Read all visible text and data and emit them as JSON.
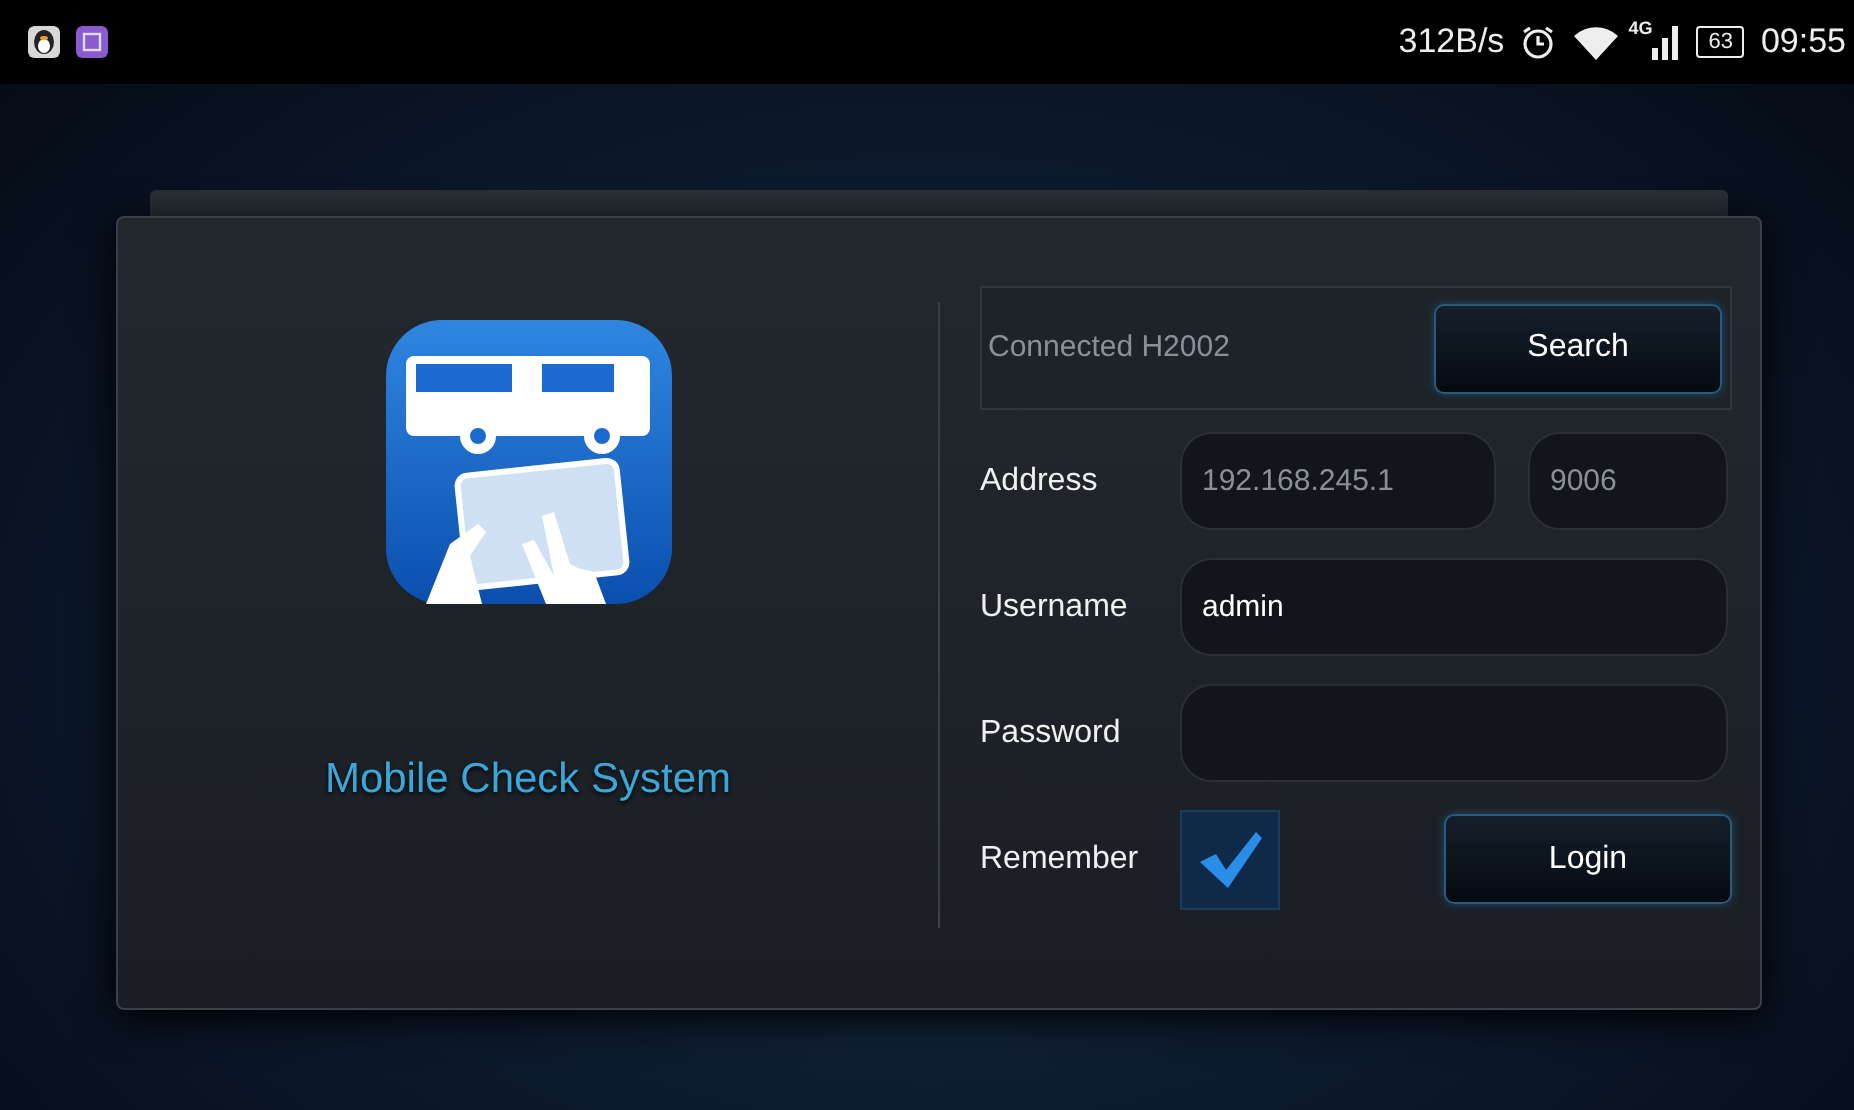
{
  "status_bar": {
    "speed": "312B/s",
    "network": "4G",
    "battery": "63",
    "time": "09:55"
  },
  "app": {
    "title": "Mobile Check System"
  },
  "form": {
    "connection": "Connected H2002",
    "search_button": "Search",
    "address": {
      "label": "Address",
      "host_placeholder": "192.168.245.1",
      "port_placeholder": "9006"
    },
    "username": {
      "label": "Username",
      "value": "admin"
    },
    "password": {
      "label": "Password"
    },
    "remember": {
      "label": "Remember",
      "checked": true
    },
    "login_button": "Login"
  }
}
